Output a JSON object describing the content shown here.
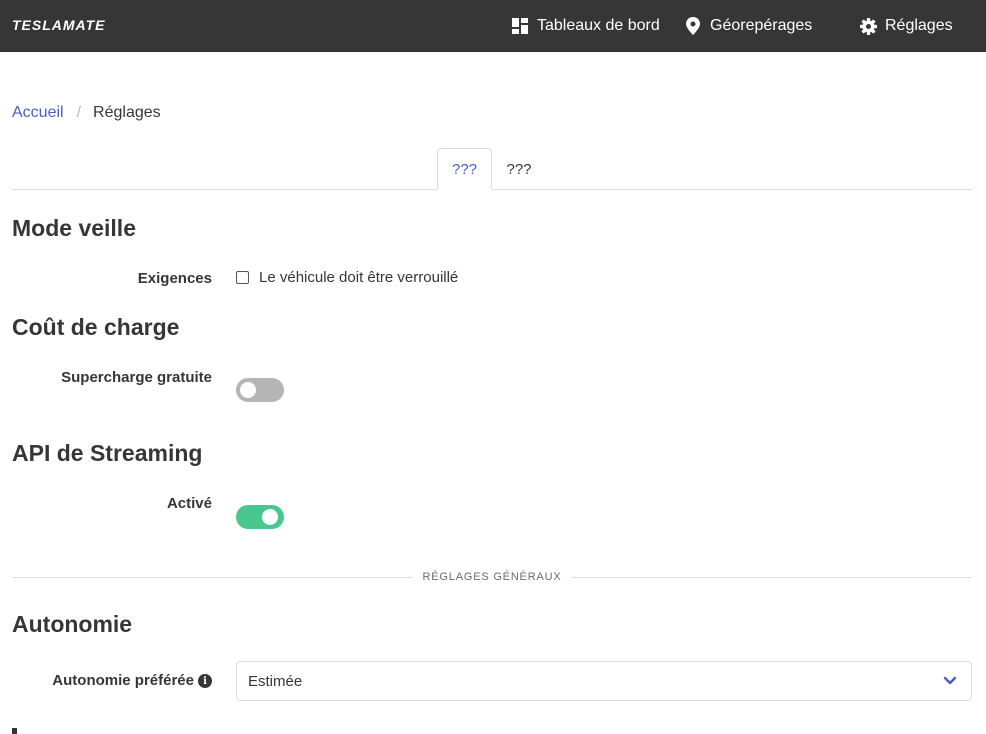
{
  "app": {
    "brand": "TESLAMATE"
  },
  "nav": {
    "dashboards": "Tableaux de bord",
    "geofences": "Géorepérages",
    "settings": "Réglages"
  },
  "breadcrumb": {
    "home": "Accueil",
    "separator": "/",
    "current": "Réglages"
  },
  "tabs": [
    {
      "label": "???",
      "active": true
    },
    {
      "label": "???",
      "active": false
    }
  ],
  "sleep_mode": {
    "title": "Mode veille",
    "requirements_label": "Exigences",
    "locked_checkbox_label": "Le véhicule doit être verrouillé",
    "locked_checked": false
  },
  "charge_cost": {
    "title": "Coût de charge",
    "free_supercharging_label": "Supercharge gratuite",
    "free_supercharging_enabled": false
  },
  "streaming": {
    "title": "API de Streaming",
    "enabled_label": "Activé",
    "enabled": true
  },
  "general": {
    "divider": "RÉGLAGES GÉNÉRAUX"
  },
  "range": {
    "title": "Autonomie",
    "preferred_label": "Autonomie préférée",
    "preferred_value": "Estimée"
  },
  "colors": {
    "navbar": "#363636",
    "link": "#485fc7",
    "toggle_on": "#48c78e",
    "toggle_off": "#b5b5b5"
  },
  "icons": [
    "dashboard-icon",
    "map-pin-icon",
    "gear-icon",
    "info-icon",
    "chevron-down-icon"
  ]
}
